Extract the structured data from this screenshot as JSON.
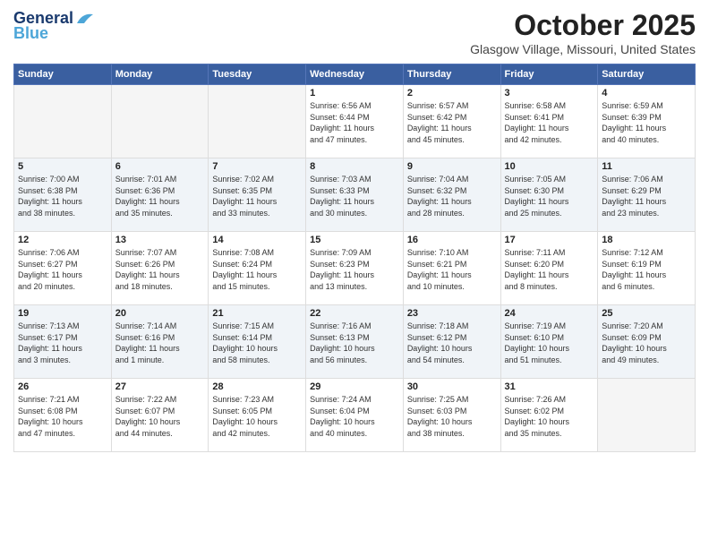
{
  "header": {
    "logo_line1": "General",
    "logo_line2": "Blue",
    "month": "October 2025",
    "location": "Glasgow Village, Missouri, United States"
  },
  "weekdays": [
    "Sunday",
    "Monday",
    "Tuesday",
    "Wednesday",
    "Thursday",
    "Friday",
    "Saturday"
  ],
  "weeks": [
    [
      {
        "day": "",
        "info": ""
      },
      {
        "day": "",
        "info": ""
      },
      {
        "day": "",
        "info": ""
      },
      {
        "day": "1",
        "info": "Sunrise: 6:56 AM\nSunset: 6:44 PM\nDaylight: 11 hours\nand 47 minutes."
      },
      {
        "day": "2",
        "info": "Sunrise: 6:57 AM\nSunset: 6:42 PM\nDaylight: 11 hours\nand 45 minutes."
      },
      {
        "day": "3",
        "info": "Sunrise: 6:58 AM\nSunset: 6:41 PM\nDaylight: 11 hours\nand 42 minutes."
      },
      {
        "day": "4",
        "info": "Sunrise: 6:59 AM\nSunset: 6:39 PM\nDaylight: 11 hours\nand 40 minutes."
      }
    ],
    [
      {
        "day": "5",
        "info": "Sunrise: 7:00 AM\nSunset: 6:38 PM\nDaylight: 11 hours\nand 38 minutes."
      },
      {
        "day": "6",
        "info": "Sunrise: 7:01 AM\nSunset: 6:36 PM\nDaylight: 11 hours\nand 35 minutes."
      },
      {
        "day": "7",
        "info": "Sunrise: 7:02 AM\nSunset: 6:35 PM\nDaylight: 11 hours\nand 33 minutes."
      },
      {
        "day": "8",
        "info": "Sunrise: 7:03 AM\nSunset: 6:33 PM\nDaylight: 11 hours\nand 30 minutes."
      },
      {
        "day": "9",
        "info": "Sunrise: 7:04 AM\nSunset: 6:32 PM\nDaylight: 11 hours\nand 28 minutes."
      },
      {
        "day": "10",
        "info": "Sunrise: 7:05 AM\nSunset: 6:30 PM\nDaylight: 11 hours\nand 25 minutes."
      },
      {
        "day": "11",
        "info": "Sunrise: 7:06 AM\nSunset: 6:29 PM\nDaylight: 11 hours\nand 23 minutes."
      }
    ],
    [
      {
        "day": "12",
        "info": "Sunrise: 7:06 AM\nSunset: 6:27 PM\nDaylight: 11 hours\nand 20 minutes."
      },
      {
        "day": "13",
        "info": "Sunrise: 7:07 AM\nSunset: 6:26 PM\nDaylight: 11 hours\nand 18 minutes."
      },
      {
        "day": "14",
        "info": "Sunrise: 7:08 AM\nSunset: 6:24 PM\nDaylight: 11 hours\nand 15 minutes."
      },
      {
        "day": "15",
        "info": "Sunrise: 7:09 AM\nSunset: 6:23 PM\nDaylight: 11 hours\nand 13 minutes."
      },
      {
        "day": "16",
        "info": "Sunrise: 7:10 AM\nSunset: 6:21 PM\nDaylight: 11 hours\nand 10 minutes."
      },
      {
        "day": "17",
        "info": "Sunrise: 7:11 AM\nSunset: 6:20 PM\nDaylight: 11 hours\nand 8 minutes."
      },
      {
        "day": "18",
        "info": "Sunrise: 7:12 AM\nSunset: 6:19 PM\nDaylight: 11 hours\nand 6 minutes."
      }
    ],
    [
      {
        "day": "19",
        "info": "Sunrise: 7:13 AM\nSunset: 6:17 PM\nDaylight: 11 hours\nand 3 minutes."
      },
      {
        "day": "20",
        "info": "Sunrise: 7:14 AM\nSunset: 6:16 PM\nDaylight: 11 hours\nand 1 minute."
      },
      {
        "day": "21",
        "info": "Sunrise: 7:15 AM\nSunset: 6:14 PM\nDaylight: 10 hours\nand 58 minutes."
      },
      {
        "day": "22",
        "info": "Sunrise: 7:16 AM\nSunset: 6:13 PM\nDaylight: 10 hours\nand 56 minutes."
      },
      {
        "day": "23",
        "info": "Sunrise: 7:18 AM\nSunset: 6:12 PM\nDaylight: 10 hours\nand 54 minutes."
      },
      {
        "day": "24",
        "info": "Sunrise: 7:19 AM\nSunset: 6:10 PM\nDaylight: 10 hours\nand 51 minutes."
      },
      {
        "day": "25",
        "info": "Sunrise: 7:20 AM\nSunset: 6:09 PM\nDaylight: 10 hours\nand 49 minutes."
      }
    ],
    [
      {
        "day": "26",
        "info": "Sunrise: 7:21 AM\nSunset: 6:08 PM\nDaylight: 10 hours\nand 47 minutes."
      },
      {
        "day": "27",
        "info": "Sunrise: 7:22 AM\nSunset: 6:07 PM\nDaylight: 10 hours\nand 44 minutes."
      },
      {
        "day": "28",
        "info": "Sunrise: 7:23 AM\nSunset: 6:05 PM\nDaylight: 10 hours\nand 42 minutes."
      },
      {
        "day": "29",
        "info": "Sunrise: 7:24 AM\nSunset: 6:04 PM\nDaylight: 10 hours\nand 40 minutes."
      },
      {
        "day": "30",
        "info": "Sunrise: 7:25 AM\nSunset: 6:03 PM\nDaylight: 10 hours\nand 38 minutes."
      },
      {
        "day": "31",
        "info": "Sunrise: 7:26 AM\nSunset: 6:02 PM\nDaylight: 10 hours\nand 35 minutes."
      },
      {
        "day": "",
        "info": ""
      }
    ]
  ]
}
